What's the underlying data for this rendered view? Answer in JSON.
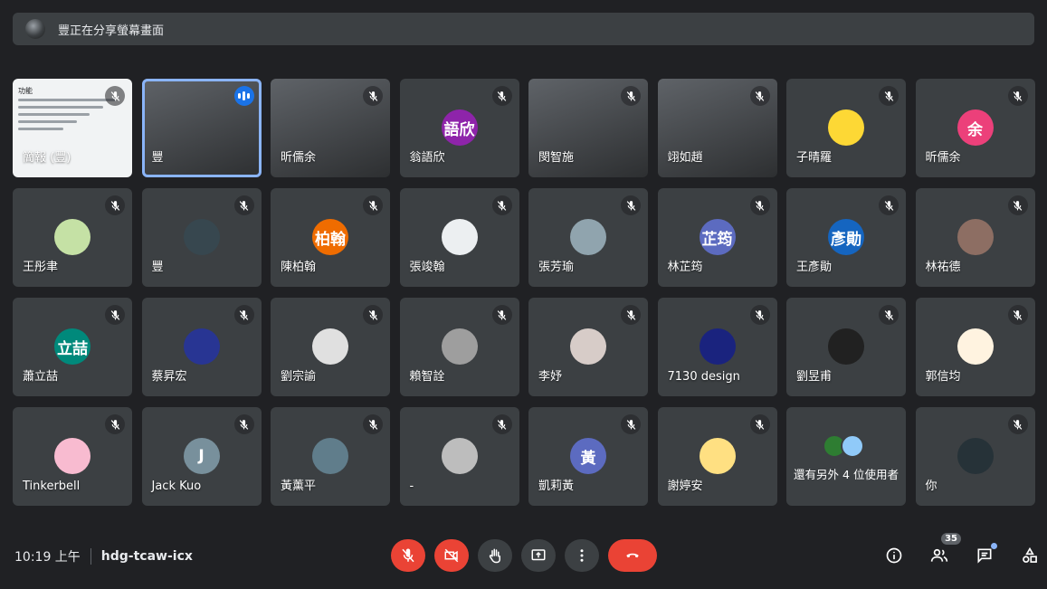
{
  "banner": {
    "text": "豐正在分享螢幕畫面"
  },
  "tiles": [
    {
      "name": "簡報 (豐)",
      "type": "screen",
      "doc_title": "功能"
    },
    {
      "name": "豐",
      "type": "video",
      "speaking": true,
      "active": true
    },
    {
      "name": "昕儒余",
      "type": "video"
    },
    {
      "name": "翁語欣",
      "type": "avatar",
      "initials": "語欣",
      "color": "#8e24aa"
    },
    {
      "name": "閔智施",
      "type": "video"
    },
    {
      "name": "翊如趙",
      "type": "video"
    },
    {
      "name": "子晴羅",
      "type": "avatar",
      "initials": "",
      "color": "#fdd835"
    },
    {
      "name": "昕儒余",
      "type": "avatar",
      "initials": "余",
      "color": "#ec407a"
    },
    {
      "name": "王彤聿",
      "type": "avatar",
      "initials": "",
      "color": "#c5e1a5"
    },
    {
      "name": "豐",
      "type": "avatar",
      "initials": "",
      "color": "#37474f"
    },
    {
      "name": "陳柏翰",
      "type": "avatar",
      "initials": "柏翰",
      "color": "#ef6c00"
    },
    {
      "name": "張竣翰",
      "type": "avatar",
      "initials": "",
      "color": "#eceff1"
    },
    {
      "name": "張芳瑜",
      "type": "avatar",
      "initials": "",
      "color": "#90a4ae"
    },
    {
      "name": "林芷筠",
      "type": "avatar",
      "initials": "芷筠",
      "color": "#5c6bc0"
    },
    {
      "name": "王彥勛",
      "type": "avatar",
      "initials": "彥勛",
      "color": "#1565c0"
    },
    {
      "name": "林祐德",
      "type": "avatar",
      "initials": "",
      "color": "#8d6e63"
    },
    {
      "name": "蕭立喆",
      "type": "avatar",
      "initials": "立喆",
      "color": "#00897b"
    },
    {
      "name": "蔡昇宏",
      "type": "avatar",
      "initials": "",
      "color": "#283593"
    },
    {
      "name": "劉宗諭",
      "type": "avatar",
      "initials": "",
      "color": "#e0e0e0"
    },
    {
      "name": "賴智詮",
      "type": "avatar",
      "initials": "",
      "color": "#9e9e9e"
    },
    {
      "name": "李妤",
      "type": "avatar",
      "initials": "",
      "color": "#d7ccc8"
    },
    {
      "name": "7130 design",
      "type": "avatar",
      "initials": "",
      "color": "#1a237e"
    },
    {
      "name": "劉昱甫",
      "type": "avatar",
      "initials": "",
      "color": "#212121"
    },
    {
      "name": "郭信均",
      "type": "avatar",
      "initials": "",
      "color": "#fff3e0"
    },
    {
      "name": "Tinkerbell",
      "type": "avatar",
      "initials": "",
      "color": "#f8bbd0"
    },
    {
      "name": "Jack Kuo",
      "type": "avatar",
      "initials": "J",
      "color": "#78909c"
    },
    {
      "name": "黃薰平",
      "type": "avatar",
      "initials": "",
      "color": "#607d8b"
    },
    {
      "name": "-",
      "type": "avatar",
      "initials": "",
      "color": "#bdbdbd"
    },
    {
      "name": "凱莉黃",
      "type": "avatar",
      "initials": "黃",
      "color": "#5c6bc0"
    },
    {
      "name": "謝婷安",
      "type": "avatar",
      "initials": "",
      "color": "#ffe082"
    },
    {
      "name": "還有另外 4 位使用者",
      "type": "more"
    },
    {
      "name": "你",
      "type": "avatar",
      "initials": "",
      "color": "#263238"
    }
  ],
  "footer": {
    "time": "10:19 上午",
    "meeting_code": "hdg-tcaw-icx",
    "participant_count": "35"
  },
  "colors": {
    "accent": "#8ab4f8",
    "danger": "#ea4335",
    "tile_bg": "#3c4043",
    "page_bg": "#202124"
  },
  "icons": {
    "controls": [
      "mic-off-icon",
      "camera-off-icon",
      "raise-hand-icon",
      "present-screen-icon",
      "more-options-icon",
      "end-call-icon"
    ],
    "right": [
      "info-icon",
      "people-icon",
      "chat-icon",
      "activities-icon"
    ]
  }
}
